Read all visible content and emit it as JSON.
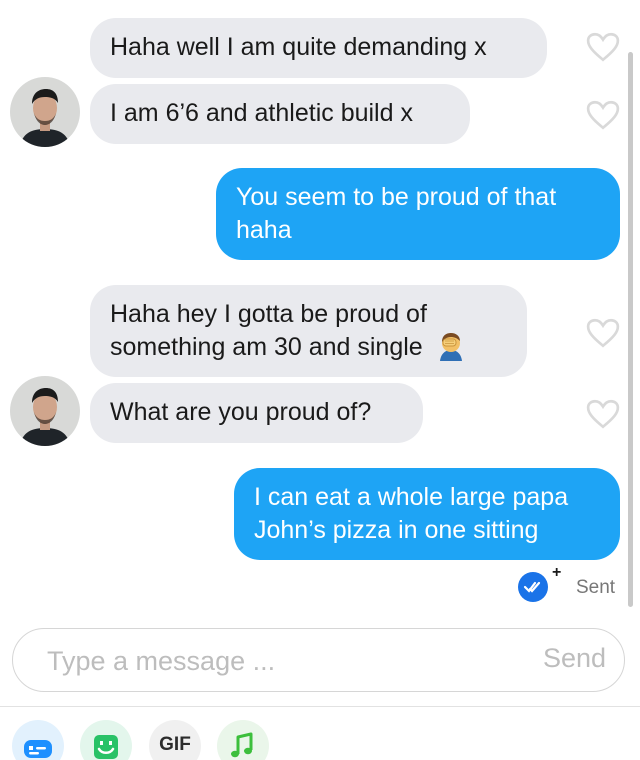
{
  "messages": [
    {
      "from": "them",
      "text": "Haha well I am quite demanding x"
    },
    {
      "from": "them",
      "text": "I am 6’6 and athletic build x"
    },
    {
      "from": "me",
      "lines": [
        "You seem to be proud of that",
        "haha"
      ]
    },
    {
      "from": "them",
      "lines": [
        "Haha hey I gotta be proud of",
        "something am 30 and single"
      ],
      "emoji": "facepalm-emoji"
    },
    {
      "from": "them",
      "text": "What are you proud of?"
    },
    {
      "from": "me",
      "lines": [
        "I can eat a whole large papa",
        "John’s pizza in one sitting"
      ]
    }
  ],
  "status": {
    "sent_label": "Sent",
    "plus": "+"
  },
  "composer": {
    "placeholder": "Type a message ...",
    "send_label": "Send"
  },
  "toolbar": {
    "gif_label": "GIF",
    "icons": [
      "sticker-icon",
      "bitmoji-icon",
      "gif-icon",
      "music-icon"
    ]
  },
  "colors": {
    "sent_bubble": "#1ea4f5",
    "received_bubble": "#e9eaee",
    "read_badge": "#1a73e8"
  }
}
